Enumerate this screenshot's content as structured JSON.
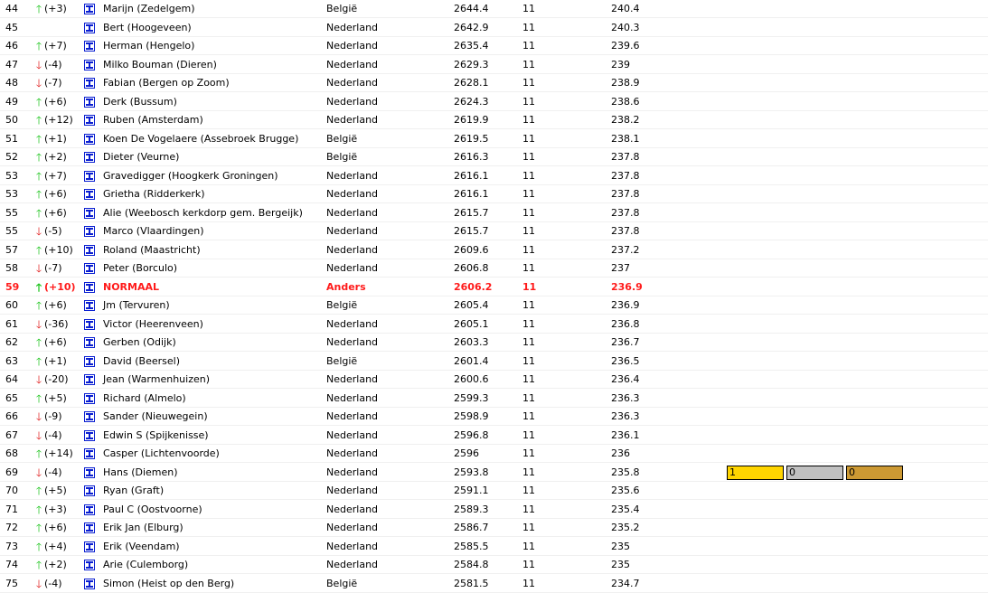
{
  "rows": [
    {
      "rank": "44",
      "dir": "up",
      "change": "(+3)",
      "name": "Marijn (Zedelgem)",
      "country": "België",
      "score": "2644.4",
      "games": "11",
      "avg": "240.4"
    },
    {
      "rank": "45",
      "dir": "",
      "change": "",
      "name": "Bert (Hoogeveen)",
      "country": "Nederland",
      "score": "2642.9",
      "games": "11",
      "avg": "240.3"
    },
    {
      "rank": "46",
      "dir": "up",
      "change": "(+7)",
      "name": "Herman (Hengelo)",
      "country": "Nederland",
      "score": "2635.4",
      "games": "11",
      "avg": "239.6"
    },
    {
      "rank": "47",
      "dir": "down",
      "change": "(-4)",
      "name": "Milko Bouman (Dieren)",
      "country": "Nederland",
      "score": "2629.3",
      "games": "11",
      "avg": "239"
    },
    {
      "rank": "48",
      "dir": "down",
      "change": "(-7)",
      "name": "Fabian (Bergen op Zoom)",
      "country": "Nederland",
      "score": "2628.1",
      "games": "11",
      "avg": "238.9"
    },
    {
      "rank": "49",
      "dir": "up",
      "change": "(+6)",
      "name": "Derk (Bussum)",
      "country": "Nederland",
      "score": "2624.3",
      "games": "11",
      "avg": "238.6"
    },
    {
      "rank": "50",
      "dir": "up",
      "change": "(+12)",
      "name": "Ruben (Amsterdam)",
      "country": "Nederland",
      "score": "2619.9",
      "games": "11",
      "avg": "238.2"
    },
    {
      "rank": "51",
      "dir": "up",
      "change": "(+1)",
      "name": "Koen De Vogelaere (Assebroek Brugge)",
      "country": "België",
      "score": "2619.5",
      "games": "11",
      "avg": "238.1"
    },
    {
      "rank": "52",
      "dir": "up",
      "change": "(+2)",
      "name": "Dieter (Veurne)",
      "country": "België",
      "score": "2616.3",
      "games": "11",
      "avg": "237.8"
    },
    {
      "rank": "53",
      "dir": "up",
      "change": "(+7)",
      "name": "Gravedigger (Hoogkerk Groningen)",
      "country": "Nederland",
      "score": "2616.1",
      "games": "11",
      "avg": "237.8"
    },
    {
      "rank": "53",
      "dir": "up",
      "change": "(+6)",
      "name": "Grietha (Ridderkerk)",
      "country": "Nederland",
      "score": "2616.1",
      "games": "11",
      "avg": "237.8"
    },
    {
      "rank": "55",
      "dir": "up",
      "change": "(+6)",
      "name": "Alie (Weebosch kerkdorp gem. Bergeijk)",
      "country": "Nederland",
      "score": "2615.7",
      "games": "11",
      "avg": "237.8"
    },
    {
      "rank": "55",
      "dir": "down",
      "change": "(-5)",
      "name": "Marco (Vlaardingen)",
      "country": "Nederland",
      "score": "2615.7",
      "games": "11",
      "avg": "237.8"
    },
    {
      "rank": "57",
      "dir": "up",
      "change": "(+10)",
      "name": "Roland (Maastricht)",
      "country": "Nederland",
      "score": "2609.6",
      "games": "11",
      "avg": "237.2"
    },
    {
      "rank": "58",
      "dir": "down",
      "change": "(-7)",
      "name": "Peter (Borculo)",
      "country": "Nederland",
      "score": "2606.8",
      "games": "11",
      "avg": "237"
    },
    {
      "rank": "59",
      "dir": "up",
      "change": "(+10)",
      "name": "NORMAAL",
      "country": "Anders",
      "score": "2606.2",
      "games": "11",
      "avg": "236.9",
      "highlight": true
    },
    {
      "rank": "60",
      "dir": "up",
      "change": "(+6)",
      "name": "Jm (Tervuren)",
      "country": "België",
      "score": "2605.4",
      "games": "11",
      "avg": "236.9"
    },
    {
      "rank": "61",
      "dir": "down",
      "change": "(-36)",
      "name": "Victor (Heerenveen)",
      "country": "Nederland",
      "score": "2605.1",
      "games": "11",
      "avg": "236.8"
    },
    {
      "rank": "62",
      "dir": "up",
      "change": "(+6)",
      "name": "Gerben (Odijk)",
      "country": "Nederland",
      "score": "2603.3",
      "games": "11",
      "avg": "236.7"
    },
    {
      "rank": "63",
      "dir": "up",
      "change": "(+1)",
      "name": "David (Beersel)",
      "country": "België",
      "score": "2601.4",
      "games": "11",
      "avg": "236.5"
    },
    {
      "rank": "64",
      "dir": "down",
      "change": "(-20)",
      "name": "Jean (Warmenhuizen)",
      "country": "Nederland",
      "score": "2600.6",
      "games": "11",
      "avg": "236.4"
    },
    {
      "rank": "65",
      "dir": "up",
      "change": "(+5)",
      "name": "Richard (Almelo)",
      "country": "Nederland",
      "score": "2599.3",
      "games": "11",
      "avg": "236.3"
    },
    {
      "rank": "66",
      "dir": "down",
      "change": "(-9)",
      "name": "Sander (Nieuwegein)",
      "country": "Nederland",
      "score": "2598.9",
      "games": "11",
      "avg": "236.3"
    },
    {
      "rank": "67",
      "dir": "down",
      "change": "(-4)",
      "name": "Edwin S (Spijkenisse)",
      "country": "Nederland",
      "score": "2596.8",
      "games": "11",
      "avg": "236.1"
    },
    {
      "rank": "68",
      "dir": "up",
      "change": "(+14)",
      "name": "Casper (Lichtenvoorde)",
      "country": "Nederland",
      "score": "2596",
      "games": "11",
      "avg": "236"
    },
    {
      "rank": "69",
      "dir": "down",
      "change": "(-4)",
      "name": "Hans (Diemen)",
      "country": "Nederland",
      "score": "2593.8",
      "games": "11",
      "avg": "235.8",
      "medals": {
        "gold": "1",
        "silver": "0",
        "bronze": "0"
      }
    },
    {
      "rank": "70",
      "dir": "up",
      "change": "(+5)",
      "name": "Ryan (Graft)",
      "country": "Nederland",
      "score": "2591.1",
      "games": "11",
      "avg": "235.6"
    },
    {
      "rank": "71",
      "dir": "up",
      "change": "(+3)",
      "name": "Paul C (Oostvoorne)",
      "country": "Nederland",
      "score": "2589.3",
      "games": "11",
      "avg": "235.4"
    },
    {
      "rank": "72",
      "dir": "up",
      "change": "(+6)",
      "name": "Erik Jan (Elburg)",
      "country": "Nederland",
      "score": "2586.7",
      "games": "11",
      "avg": "235.2"
    },
    {
      "rank": "73",
      "dir": "up",
      "change": "(+4)",
      "name": "Erik (Veendam)",
      "country": "Nederland",
      "score": "2585.5",
      "games": "11",
      "avg": "235"
    },
    {
      "rank": "74",
      "dir": "up",
      "change": "(+2)",
      "name": "Arie (Culemborg)",
      "country": "Nederland",
      "score": "2584.8",
      "games": "11",
      "avg": "235"
    },
    {
      "rank": "75",
      "dir": "down",
      "change": "(-4)",
      "name": "Simon (Heist op den Berg)",
      "country": "België",
      "score": "2581.5",
      "games": "11",
      "avg": "234.7"
    }
  ],
  "arrows": {
    "up": "🡑",
    "down": "🡓"
  },
  "icon": "game-board-icon",
  "colors": {
    "up": "#19c319",
    "down": "#e01b1b",
    "highlight": "#ff1a1a",
    "gold": "#ffd500",
    "silver": "#c0c0c0",
    "bronze": "#cc9933",
    "icon": "#0a1fd1"
  }
}
